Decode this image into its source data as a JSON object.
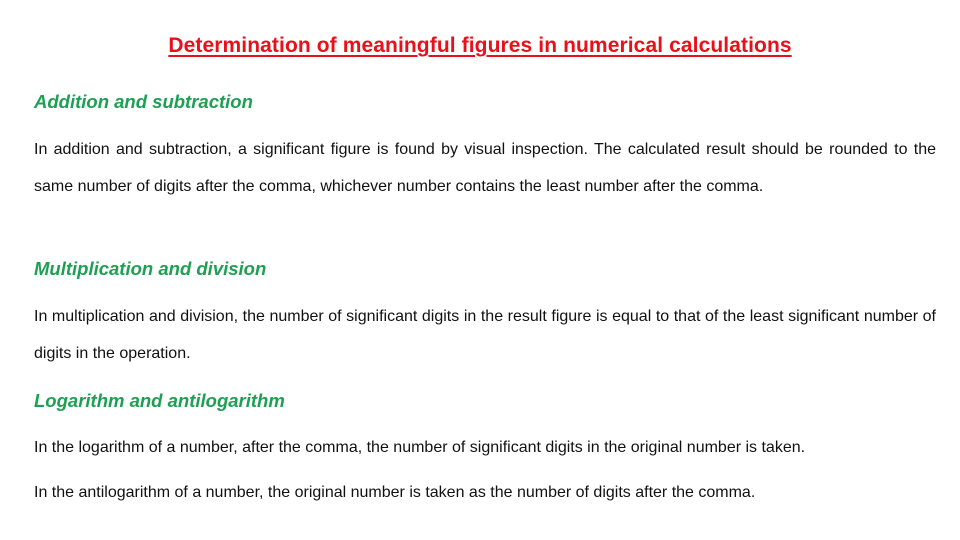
{
  "slide": {
    "title": "Determination of meaningful figures in numerical calculations",
    "colors": {
      "title": "#e8101a",
      "heading": "#1ea053",
      "body": "#111111"
    },
    "sections": [
      {
        "heading": "Addition and subtraction",
        "paragraphs": [
          "In addition and subtraction, a significant figure is found by visual inspection. The calculated result should be rounded to the same number of digits after the comma, whichever number contains the least number after the comma."
        ]
      },
      {
        "heading": "Multiplication and division",
        "paragraphs": [
          "In multiplication and division, the number of significant digits in the result figure is equal to that of the least significant number of digits in the operation."
        ]
      },
      {
        "heading": "Logarithm and antilogarithm",
        "paragraphs": [
          "In the logarithm of a number, after the comma, the number of significant digits in the original number is taken.",
          "In the antilogarithm of a number, the original number is taken as the number of digits after the comma."
        ]
      }
    ]
  }
}
